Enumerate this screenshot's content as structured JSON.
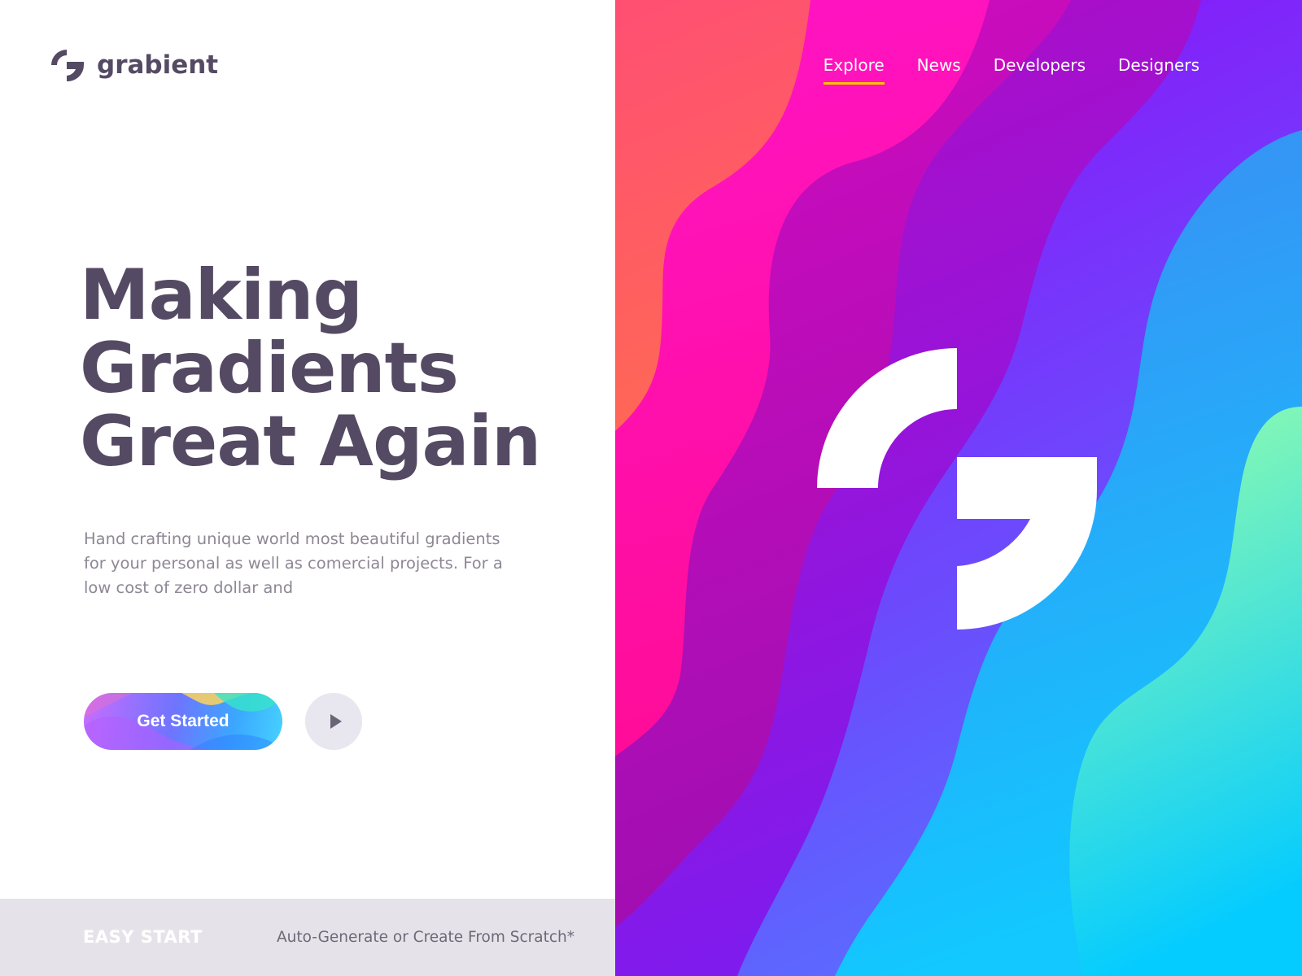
{
  "brand": {
    "name": "grabient",
    "logo_icon": "grabient-g-logo-icon",
    "text_color": "#554a63"
  },
  "nav": {
    "items": [
      {
        "label": "Explore",
        "active": true
      },
      {
        "label": "News",
        "active": false
      },
      {
        "label": "Developers",
        "active": false
      },
      {
        "label": "Designers",
        "active": false
      }
    ],
    "active_underline_color": "#ffc400"
  },
  "hero": {
    "headline": [
      "Making",
      "Gradients",
      "Great Again"
    ],
    "description": "Hand crafting unique world most beautiful gradients for your personal as well as comercial projects. For a low cost of zero dollar and",
    "cta_label": "Get Started",
    "play_icon": "play-icon"
  },
  "footer": {
    "badge": "EASY START",
    "text": "Auto-Generate or Create From Scratch*"
  },
  "colors": {
    "waves": [
      "#ff5a5f",
      "#ff0ab8",
      "#c208b4",
      "#9b14d6",
      "#7b3dff",
      "#3aa1ff",
      "#00c6ff",
      "#8ff8a8"
    ]
  }
}
